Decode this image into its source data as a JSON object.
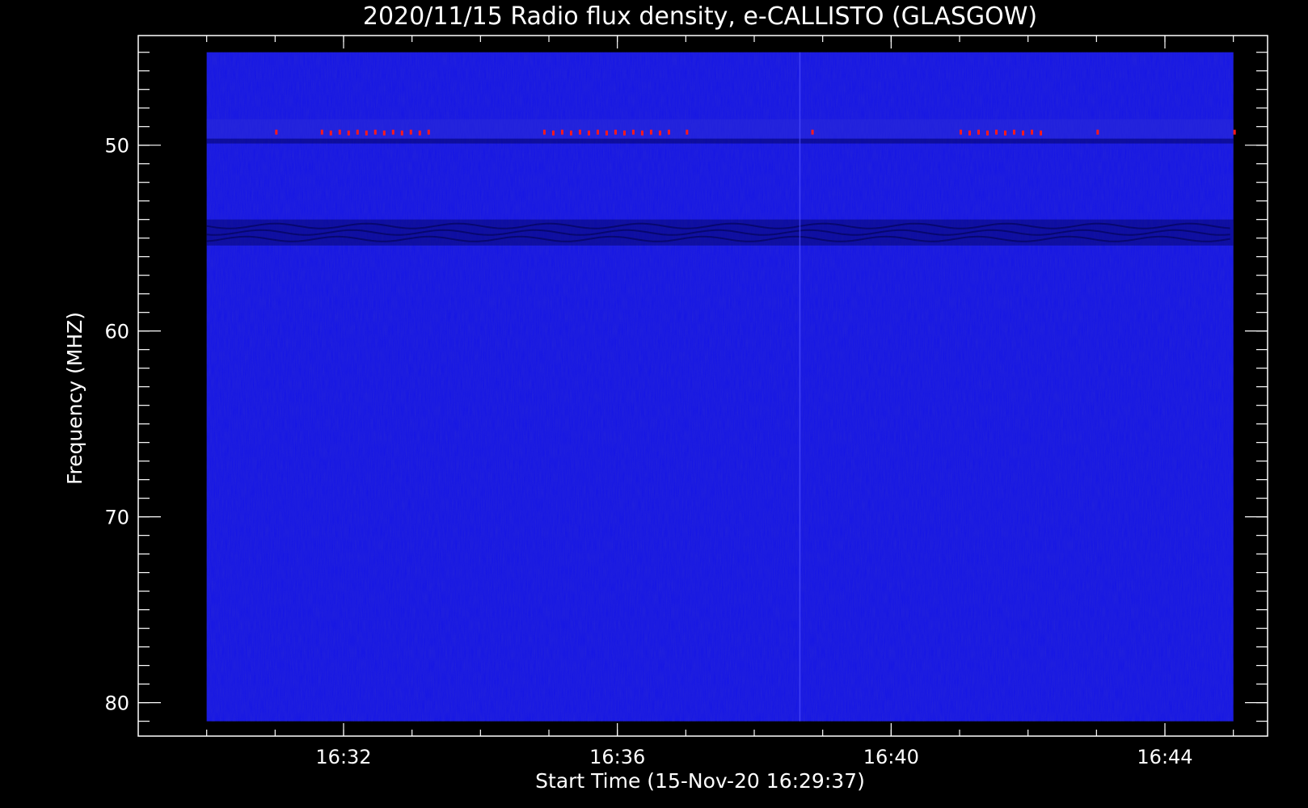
{
  "colors": {
    "background": "#000000",
    "axes": "#ffffff",
    "spectrum_base": "#1414e6",
    "burst_hot": "#ff1a1a"
  },
  "chart_data": {
    "type": "heatmap",
    "title": "2020/11/15  Radio flux density, e-CALLISTO (GLASGOW)",
    "xlabel": "Start Time (15-Nov-20 16:29:37)",
    "ylabel": "Frequency (MHZ)",
    "x_unit": "time (HH:MM)",
    "y_unit": "MHz",
    "xlim": [
      "16:29:00",
      "16:45:30"
    ],
    "ylim": [
      44.1,
      81.8
    ],
    "y_inverted": true,
    "data_extent": {
      "time": [
        "16:30:00",
        "16:45:00"
      ],
      "frequency": [
        45.0,
        81.0
      ]
    },
    "x_ticks": [
      "16:32",
      "16:36",
      "16:40",
      "16:44"
    ],
    "y_ticks": [
      50,
      60,
      70,
      80
    ],
    "x_minor_ticks": [
      "16:30",
      "16:31",
      "16:32",
      "16:33",
      "16:34",
      "16:35",
      "16:36",
      "16:37",
      "16:38",
      "16:39",
      "16:40",
      "16:41",
      "16:42",
      "16:43",
      "16:44",
      "16:45"
    ],
    "y_minor_ticks": [
      45,
      46,
      47,
      48,
      49,
      50,
      51,
      52,
      53,
      54,
      55,
      56,
      57,
      58,
      59,
      60,
      61,
      62,
      63,
      64,
      65,
      66,
      67,
      68,
      69,
      70,
      71,
      72,
      73,
      74,
      75,
      76,
      77,
      78,
      79,
      80,
      81
    ],
    "features": [
      {
        "kind": "rfi-band",
        "frequency_mhz": 49.3,
        "color": "red",
        "time_segments": [
          [
            "16:31:00",
            "16:31:05"
          ],
          [
            "16:31:40",
            "16:33:20"
          ],
          [
            "16:34:55",
            "16:36:50"
          ],
          [
            "16:37:00",
            "16:37:05"
          ],
          [
            "16:38:50",
            "16:38:55"
          ],
          [
            "16:41:00",
            "16:42:20"
          ],
          [
            "16:43:00",
            "16:43:05"
          ],
          [
            "16:45:00",
            "16:45:05"
          ]
        ]
      },
      {
        "kind": "dark-ripple-band",
        "frequency_range_mhz": [
          54.0,
          55.4
        ],
        "time_range": [
          "16:30:00",
          "16:45:00"
        ]
      },
      {
        "kind": "vertical-line",
        "time": "16:38:40",
        "frequency_range_mhz": [
          45.0,
          81.0
        ]
      }
    ]
  }
}
